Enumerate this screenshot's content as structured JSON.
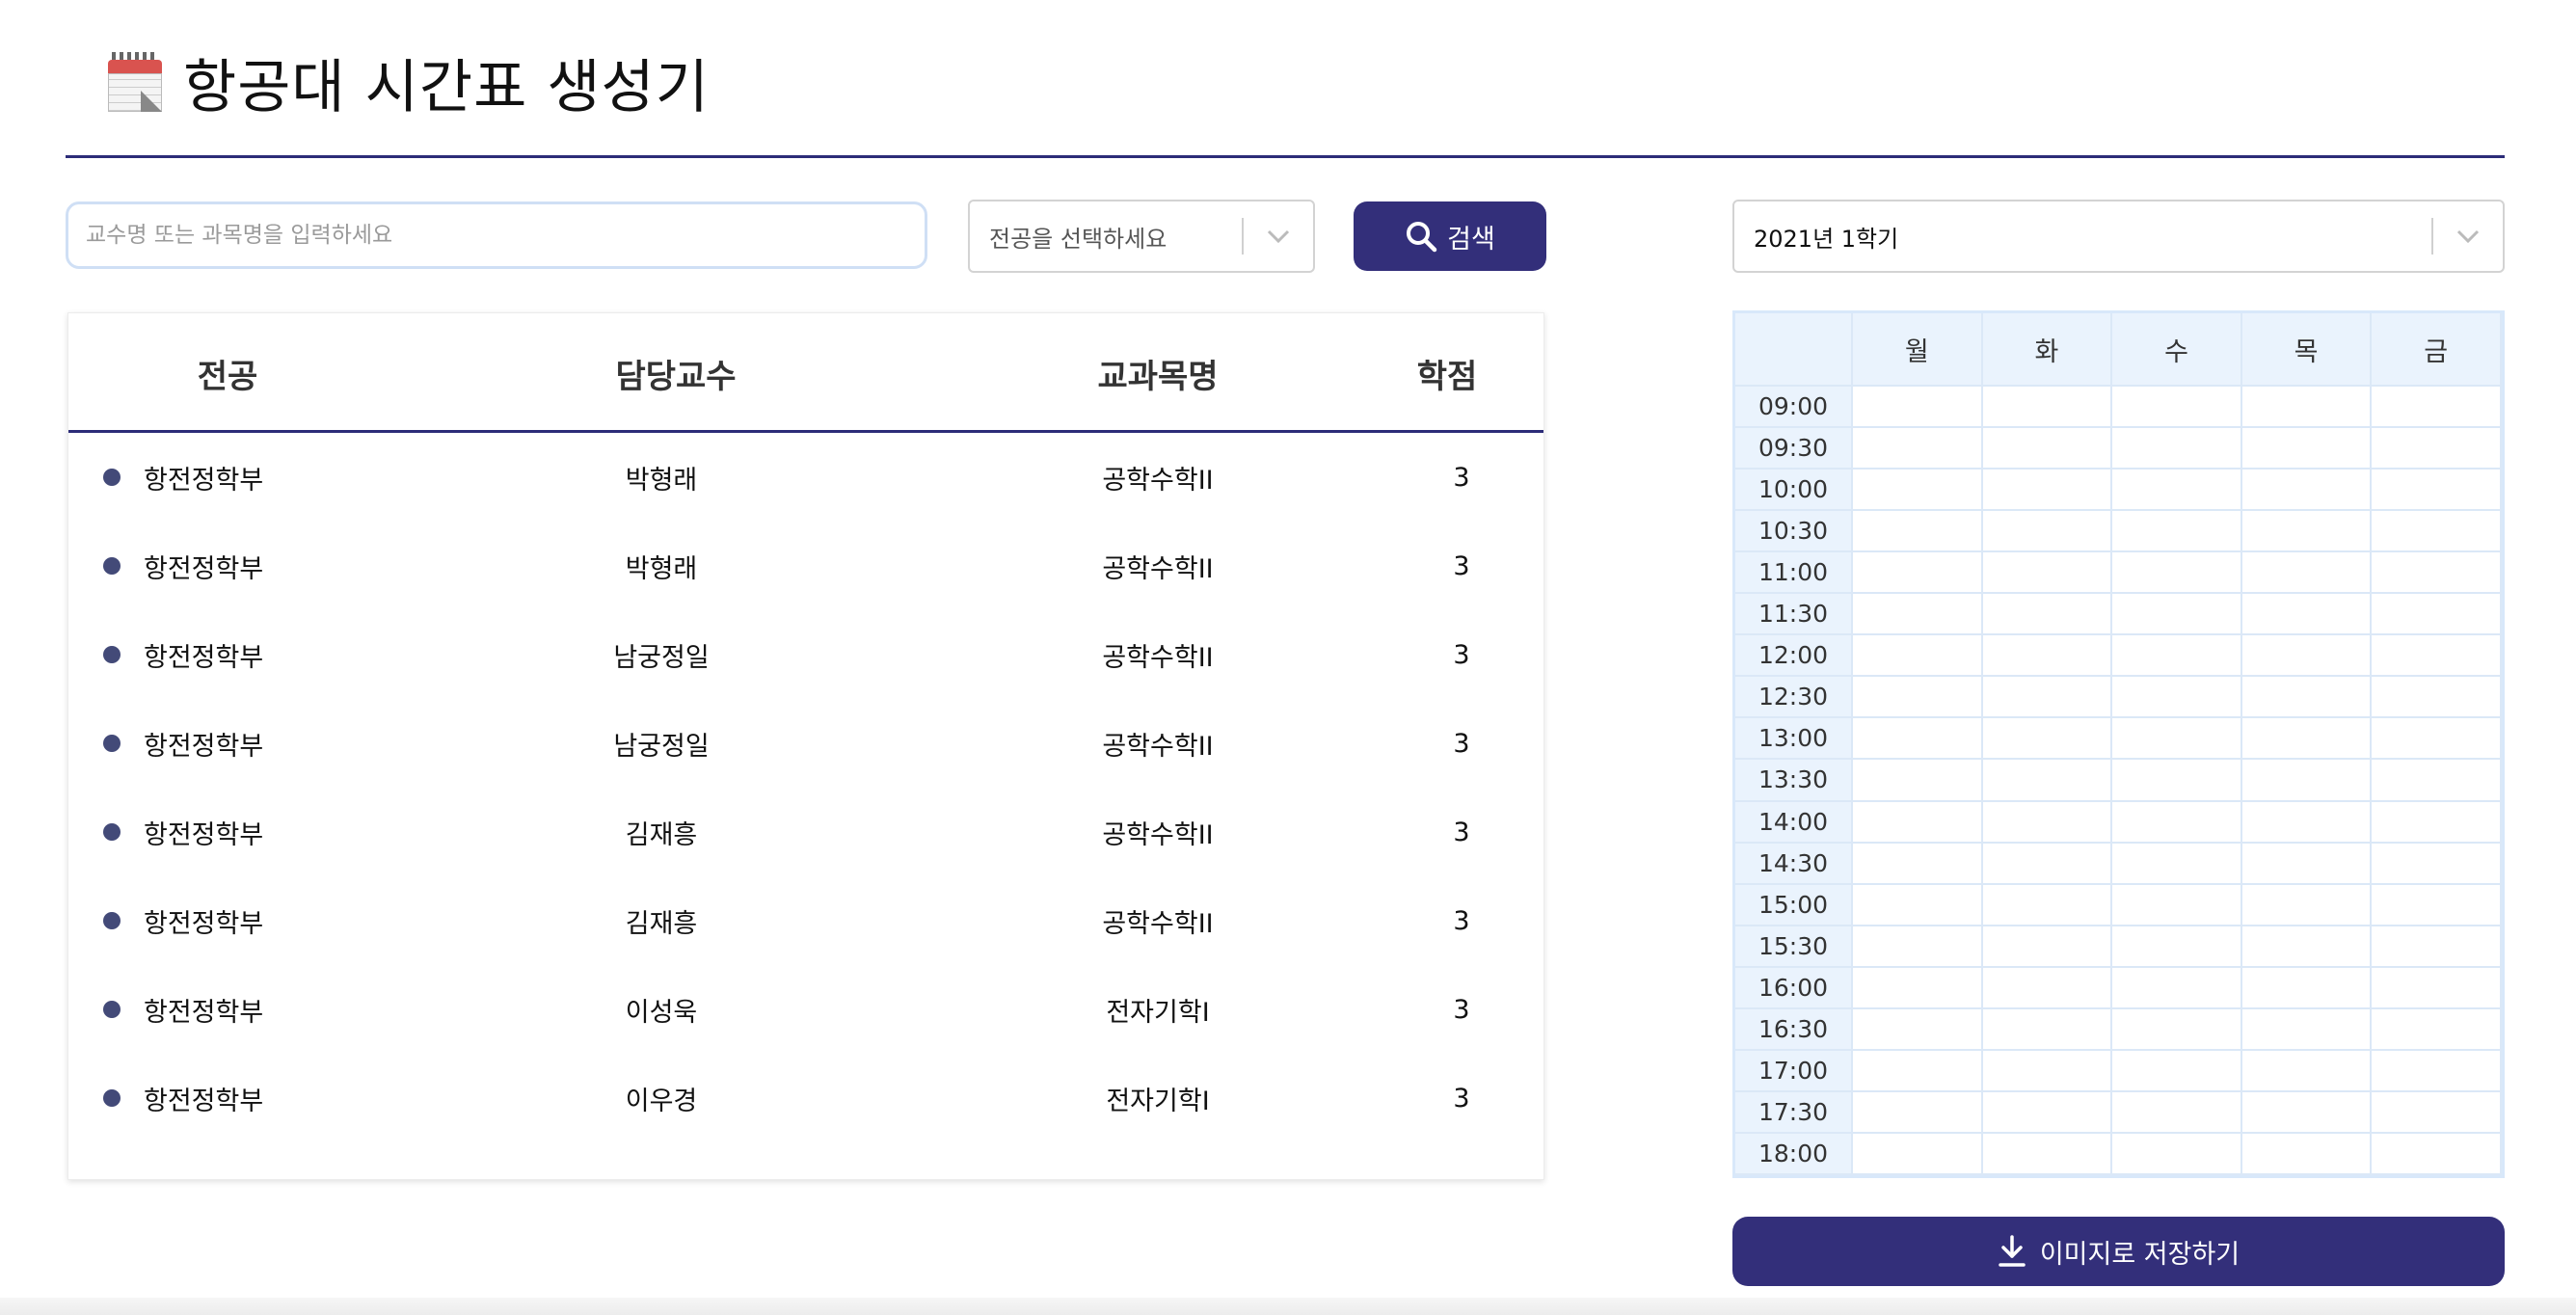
{
  "header": {
    "title": "항공대 시간표 생성기",
    "icon": "calendar-icon"
  },
  "search": {
    "placeholder": "교수명 또는 과목명을 입력하세요",
    "value": "",
    "major_placeholder": "전공을 선택하세요",
    "button_label": "검색"
  },
  "semester": {
    "selected": "2021년 1학기"
  },
  "table": {
    "headers": [
      "전공",
      "담당교수",
      "교과목명",
      "학점"
    ],
    "rows": [
      {
        "major": "항전정학부",
        "professor": "박형래",
        "course": "공학수학II",
        "credits": "3"
      },
      {
        "major": "항전정학부",
        "professor": "박형래",
        "course": "공학수학II",
        "credits": "3"
      },
      {
        "major": "항전정학부",
        "professor": "남궁정일",
        "course": "공학수학II",
        "credits": "3"
      },
      {
        "major": "항전정학부",
        "professor": "남궁정일",
        "course": "공학수학II",
        "credits": "3"
      },
      {
        "major": "항전정학부",
        "professor": "김재흥",
        "course": "공학수학II",
        "credits": "3"
      },
      {
        "major": "항전정학부",
        "professor": "김재흥",
        "course": "공학수학II",
        "credits": "3"
      },
      {
        "major": "항전정학부",
        "professor": "이성욱",
        "course": "전자기학I",
        "credits": "3"
      },
      {
        "major": "항전정학부",
        "professor": "이우경",
        "course": "전자기학I",
        "credits": "3"
      }
    ]
  },
  "timetable": {
    "days": [
      "월",
      "화",
      "수",
      "목",
      "금"
    ],
    "times": [
      "09:00",
      "09:30",
      "10:00",
      "10:30",
      "11:00",
      "11:30",
      "12:00",
      "12:30",
      "13:00",
      "13:30",
      "14:00",
      "14:30",
      "15:00",
      "15:30",
      "16:00",
      "16:30",
      "17:00",
      "17:30",
      "18:00"
    ]
  },
  "save_button": {
    "label": "이미지로 저장하기",
    "icon": "download-icon"
  },
  "colors": {
    "accent": "#332f7a",
    "header_line": "#2c2c78",
    "grid_bg": "#eaf3fd",
    "grid_line": "#dbe8f7",
    "bullet": "#434a78"
  }
}
